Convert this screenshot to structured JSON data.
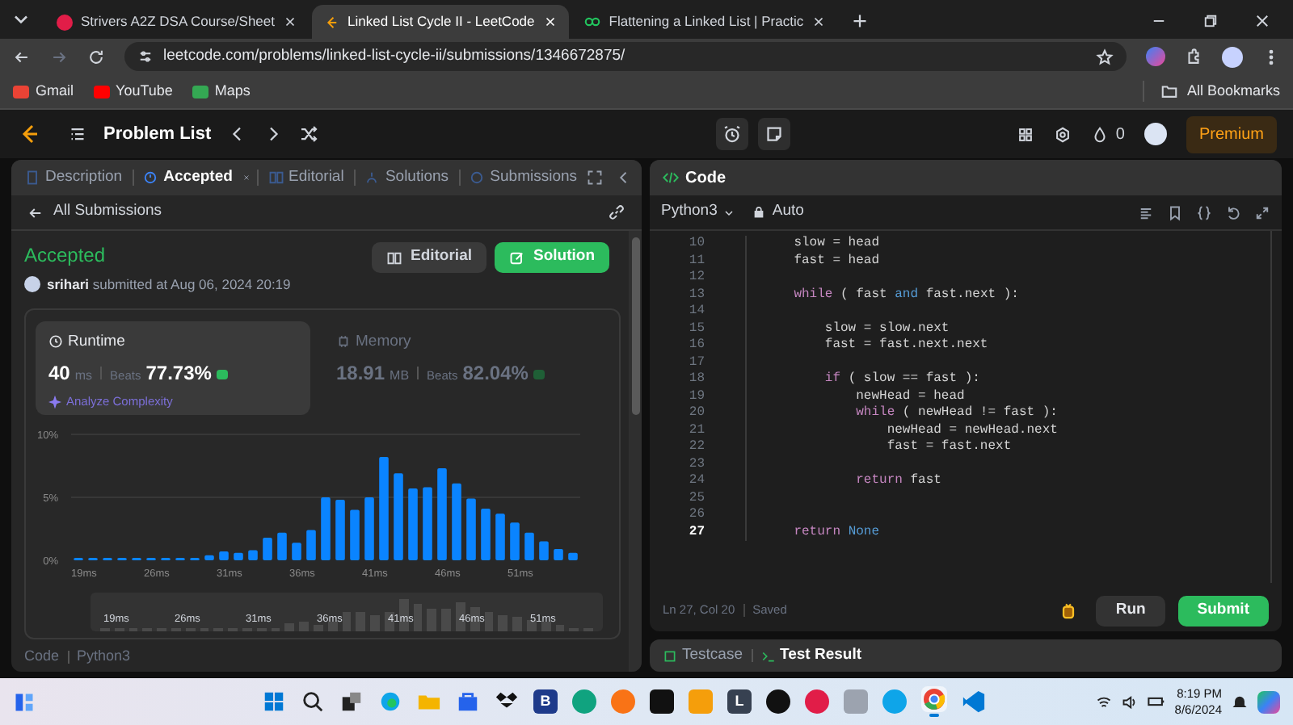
{
  "browser": {
    "tabs": [
      {
        "title": "Strivers A2Z DSA Course/Sheet",
        "selected": false,
        "kind": "badge"
      },
      {
        "title": "Linked List Cycle II - LeetCode",
        "selected": true,
        "kind": "leetcode"
      },
      {
        "title": "Flattening a Linked List | Practic",
        "selected": false,
        "kind": "loops"
      }
    ],
    "url": "leetcode.com/problems/linked-list-cycle-ii/submissions/1346672875/",
    "bookmarks": [
      {
        "label": "Gmail",
        "kind": "gmail"
      },
      {
        "label": "YouTube",
        "kind": "youtube"
      },
      {
        "label": "Maps",
        "kind": "maps"
      }
    ],
    "all_bookmarks": "All Bookmarks"
  },
  "nav": {
    "problem_list": "Problem List",
    "streak": "0",
    "premium": "Premium"
  },
  "left_panel": {
    "tabs": [
      {
        "label": "Description",
        "selected": false,
        "closable": false
      },
      {
        "label": "Accepted",
        "selected": true,
        "closable": true
      },
      {
        "label": "Editorial",
        "selected": false,
        "closable": false
      },
      {
        "label": "Solutions",
        "selected": false,
        "closable": false
      },
      {
        "label": "Submissions",
        "selected": false,
        "closable": false
      }
    ],
    "back_link": "All Submissions",
    "status": "Accepted",
    "submitted": "**srihari** submitted at Aug 06, 2024 20:19",
    "buttons": [
      {
        "label": "Editorial",
        "kind": "secondary"
      },
      {
        "label": "Solution",
        "kind": "primary"
      }
    ],
    "metrics": [
      {
        "title": "Runtime",
        "value": "40",
        "unit": "ms",
        "beats_label": "Beats",
        "beats": "77.73%",
        "selected": true,
        "link": "Analyze Complexity"
      },
      {
        "title": "Memory",
        "value": "18.91",
        "unit": "MB",
        "beats_label": "Beats",
        "beats": "82.04%",
        "selected": false
      }
    ],
    "chart_data": {
      "type": "bar",
      "yticks": [
        {
          "value": 0,
          "label": "0%"
        },
        {
          "value": 5,
          "label": "5%"
        },
        {
          "value": 10,
          "label": "10%"
        }
      ],
      "ylim": [
        0,
        10
      ],
      "categories": [
        "19ms",
        null,
        null,
        null,
        null,
        "26ms",
        null,
        null,
        null,
        null,
        "31ms",
        null,
        null,
        null,
        null,
        "36ms",
        null,
        null,
        null,
        null,
        "41ms",
        null,
        null,
        null,
        null,
        "46ms",
        null,
        null,
        null,
        null,
        "51ms",
        null,
        null,
        null,
        null
      ],
      "series": [
        {
          "color": "#0a84ff",
          "values": [
            0.2,
            0.2,
            0.2,
            0.2,
            0.2,
            0.2,
            0.2,
            0.2,
            0.2,
            0.4,
            0.7,
            0.6,
            0.8,
            1.8,
            2.2,
            1.4,
            2.4,
            5.0,
            4.8,
            4.0,
            5.0,
            8.2,
            6.9,
            5.7,
            5.8,
            7.3,
            6.1,
            4.9,
            4.1,
            3.7,
            3.0,
            2.2,
            1.5,
            0.9,
            0.6
          ]
        }
      ]
    },
    "navigator_labels": [
      "19ms",
      "26ms",
      "31ms",
      "36ms",
      "41ms",
      "46ms",
      "51ms"
    ],
    "footer": [
      "Code",
      "Python3"
    ]
  },
  "editor": {
    "title": "Code",
    "language": "Python3",
    "mode": "Auto",
    "lines": [
      {
        "number": "10",
        "current": false,
        "segments": [
          {
            "text": "    slow = head",
            "kind": "plain"
          }
        ]
      },
      {
        "number": "11",
        "current": false,
        "segments": [
          {
            "text": "    fast = head",
            "kind": "plain"
          }
        ]
      },
      {
        "number": "12",
        "current": false
      },
      {
        "number": "13",
        "current": false,
        "segments": [
          {
            "text": "    while",
            "kind": "keyword"
          },
          {
            "text": " ( fast ",
            "kind": "plain"
          },
          {
            "text": "and",
            "kind": "constant"
          },
          {
            "text": " fast.next ):",
            "kind": "plain"
          }
        ]
      },
      {
        "number": "14",
        "current": false
      },
      {
        "number": "15",
        "current": false,
        "segments": [
          {
            "text": "        slow = slow.next",
            "kind": "plain"
          }
        ]
      },
      {
        "number": "16",
        "current": false,
        "segments": [
          {
            "text": "        fast = fast.next.next",
            "kind": "plain"
          }
        ]
      },
      {
        "number": "17",
        "current": false
      },
      {
        "number": "18",
        "current": false,
        "segments": [
          {
            "text": "        if",
            "kind": "keyword"
          },
          {
            "text": " ( slow == fast ):",
            "kind": "plain"
          }
        ]
      },
      {
        "number": "19",
        "current": false,
        "segments": [
          {
            "text": "            newHead = head",
            "kind": "plain"
          }
        ]
      },
      {
        "number": "20",
        "current": false,
        "segments": [
          {
            "text": "            while",
            "kind": "keyword"
          },
          {
            "text": " ( newHead != fast ):",
            "kind": "plain"
          }
        ]
      },
      {
        "number": "21",
        "current": false,
        "segments": [
          {
            "text": "                newHead = newHead.next",
            "kind": "plain"
          }
        ]
      },
      {
        "number": "22",
        "current": false,
        "segments": [
          {
            "text": "                fast = fast.next",
            "kind": "plain"
          }
        ]
      },
      {
        "number": "23",
        "current": false
      },
      {
        "number": "24",
        "current": false,
        "segments": [
          {
            "text": "            return",
            "kind": "keyword"
          },
          {
            "text": " fast",
            "kind": "plain"
          }
        ]
      },
      {
        "number": "25",
        "current": false
      },
      {
        "number": "26",
        "current": false
      },
      {
        "number": "27",
        "current": true,
        "segments": [
          {
            "text": "    return",
            "kind": "keyword"
          },
          {
            "text": " None",
            "kind": "constant"
          }
        ]
      }
    ],
    "position": "Ln 27, Col 20",
    "saved": "Saved",
    "run": "Run",
    "submit": "Submit"
  },
  "console": {
    "tabs": [
      {
        "label": "Testcase",
        "selected": false
      },
      {
        "label": "Test Result",
        "selected": true
      }
    ]
  },
  "taskbar": {
    "apps": [
      {
        "kind": "windows"
      },
      {
        "kind": "search"
      },
      {
        "kind": "taskview"
      },
      {
        "kind": "edge"
      },
      {
        "kind": "folder"
      },
      {
        "kind": "store"
      },
      {
        "kind": "dropbox"
      },
      {
        "kind": "letter",
        "glyph": "B",
        "color": "#1e3a8a"
      },
      {
        "kind": "circle",
        "color": "#10a37f"
      },
      {
        "kind": "circle",
        "color": "#f97316"
      },
      {
        "kind": "square",
        "color": "#111111"
      },
      {
        "kind": "square",
        "color": "#f59e0b"
      },
      {
        "kind": "letter",
        "glyph": "L",
        "color": "#374151"
      },
      {
        "kind": "circle",
        "color": "#111111"
      },
      {
        "kind": "circle",
        "color": "#e11d48"
      },
      {
        "kind": "square",
        "color": "#9ca3af"
      },
      {
        "kind": "circle",
        "color": "#0ea5e9"
      },
      {
        "kind": "chrome",
        "active": true
      },
      {
        "kind": "vscode"
      }
    ],
    "time": "8:19 PM",
    "date": "8/6/2024"
  }
}
